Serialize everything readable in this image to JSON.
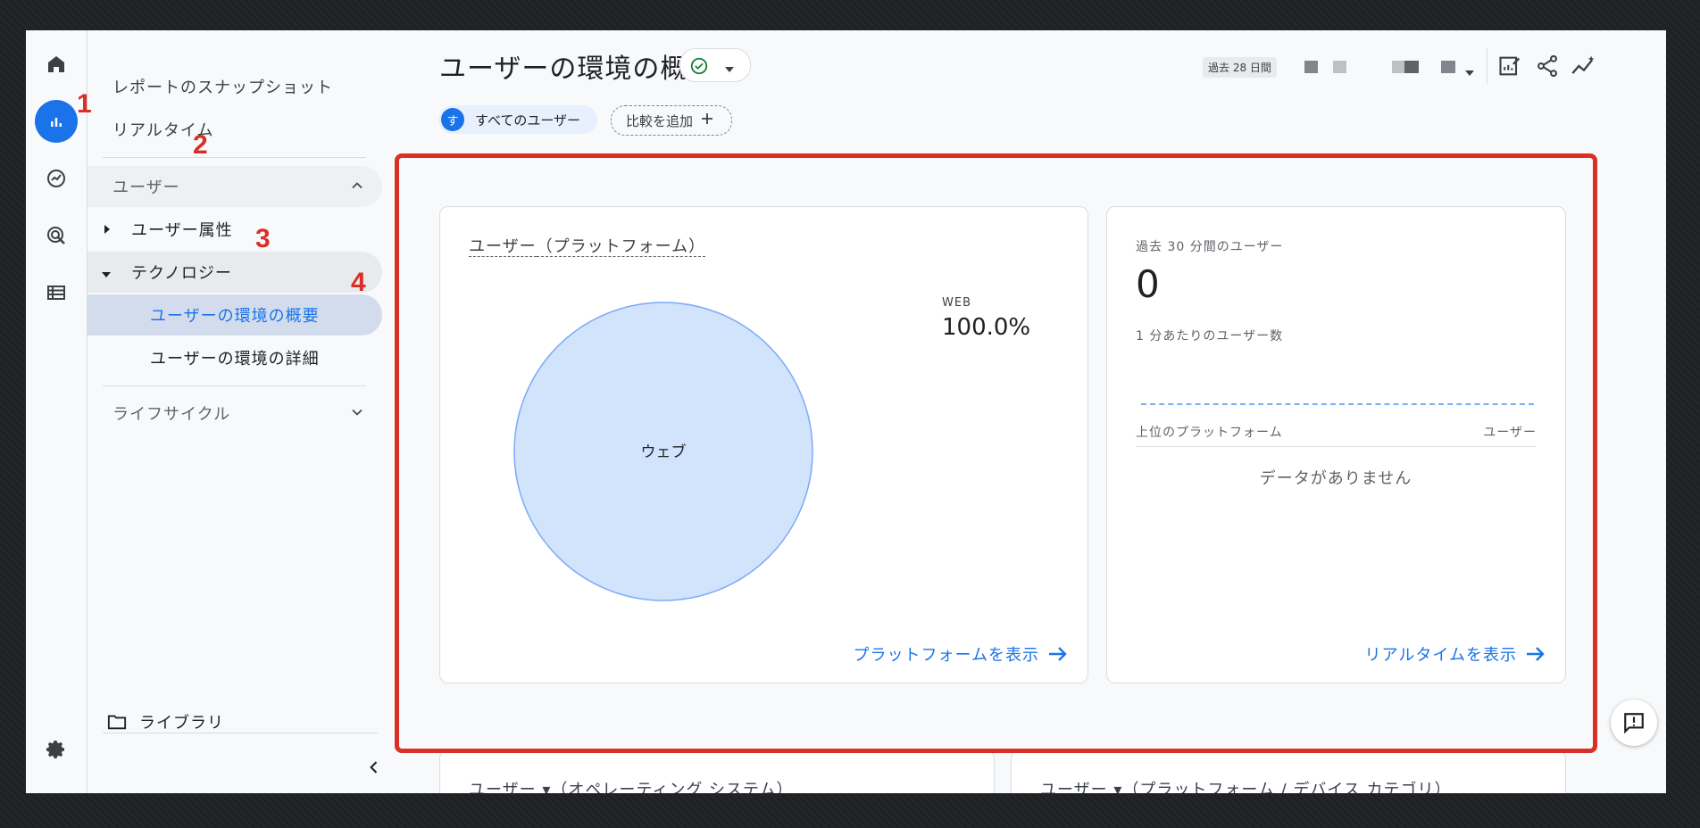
{
  "nav": {
    "snapshot": "レポートのスナップショット",
    "realtime": "リアルタイム",
    "section_user": "ユーザー",
    "user_attr": "ユーザー属性",
    "technology": "テクノロジー",
    "tech_overview": "ユーザーの環境の概要",
    "tech_detail": "ユーザーの環境の詳細",
    "lifecycle": "ライフサイクル",
    "library": "ライブラリ"
  },
  "markers": [
    "1",
    "2",
    "3",
    "4"
  ],
  "header": {
    "title": "ユーザーの環境の概要",
    "date_range": "過去 28 日間"
  },
  "filters": {
    "segment_avatar": "す",
    "segment_label": "すべてのユーザー",
    "add_compare": "比較を追加"
  },
  "platform_card": {
    "title_part1": "ユーザー",
    "title_part2": "（プラットフォーム）",
    "legend_label": "WEB",
    "legend_value": "100.0%",
    "slice_label": "ウェブ",
    "link": "プラットフォームを表示"
  },
  "chart_data": {
    "type": "pie",
    "categories": [
      "ウェブ"
    ],
    "values": [
      100.0
    ],
    "title": "ユーザー（プラットフォーム）"
  },
  "realtime_card": {
    "header": "過去 30 分間のユーザー",
    "count": "0",
    "subheader": "1 分あたりのユーザー数",
    "col_left": "上位のプラットフォーム",
    "col_right": "ユーザー",
    "empty": "データがありません",
    "link": "リアルタイムを表示"
  },
  "bottom_cards": {
    "left_title": "ユーザー ▾（オペレーティング システム）",
    "right_title": "ユーザー ▾（プラットフォーム / デバイス カテゴリ）"
  },
  "colors": {
    "accent": "#1a73e8",
    "highlight": "#d93025",
    "pie_fill": "#d2e3fc",
    "pie_stroke": "#7baaf7"
  }
}
